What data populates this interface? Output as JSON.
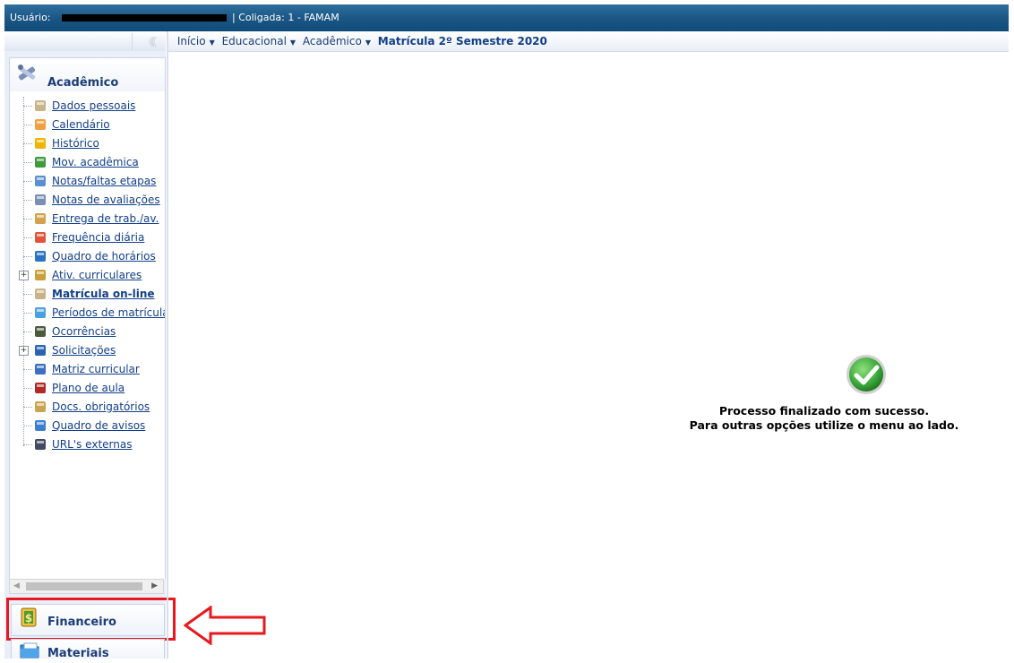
{
  "topbar": {
    "user_label": "Usuário:",
    "coligada": "| Coligada: 1 - FAMAM"
  },
  "breadcrumb": {
    "items": [
      "Início",
      "Educacional",
      "Acadêmico"
    ],
    "current": "Matrícula 2º Semestre 2020"
  },
  "sidebar": {
    "collapse": "《《",
    "active_tab": "Acadêmico",
    "items": [
      {
        "label": "Dados pessoais",
        "icon": "person-icon"
      },
      {
        "label": "Calendário",
        "icon": "calendar-icon"
      },
      {
        "label": "Histórico",
        "icon": "pencil-note-icon"
      },
      {
        "label": "Mov. acadêmica",
        "icon": "arrows-icon"
      },
      {
        "label": "Notas/faltas etapas",
        "icon": "table-icon"
      },
      {
        "label": "Notas de avaliações",
        "icon": "grades-icon"
      },
      {
        "label": "Entrega de trab./av.",
        "icon": "delivery-box-icon"
      },
      {
        "label": "Frequência diária",
        "icon": "people-icon"
      },
      {
        "label": "Quadro de horários",
        "icon": "clock-icon"
      },
      {
        "label": "Ativ. curriculares",
        "icon": "figure-icon",
        "expandable": true
      },
      {
        "label": "Matrícula on-line",
        "icon": "person-icon",
        "bold": true
      },
      {
        "label": "Períodos de matrícula",
        "icon": "calendar-period-icon"
      },
      {
        "label": "Ocorrências",
        "icon": "quill-icon"
      },
      {
        "label": "Solicitações",
        "icon": "request-icon",
        "expandable": true
      },
      {
        "label": "Matriz curricular",
        "icon": "matrix-icon"
      },
      {
        "label": "Plano de aula",
        "icon": "book-icon"
      },
      {
        "label": "Docs. obrigatórios",
        "icon": "documents-icon"
      },
      {
        "label": "Quadro de avisos",
        "icon": "notice-board-icon"
      },
      {
        "label": "URL's externas",
        "icon": "globe-icon"
      }
    ],
    "bottom_tabs": [
      "Financeiro",
      "Materiais"
    ]
  },
  "main": {
    "message_line1": "Processo finalizado com sucesso.",
    "message_line2": "Para outras opções utilize o menu ao lado."
  },
  "colors": {
    "topbar": "#1a5584",
    "link": "#123f8a",
    "highlight": "#e8181e",
    "success": "#3aa83a"
  }
}
